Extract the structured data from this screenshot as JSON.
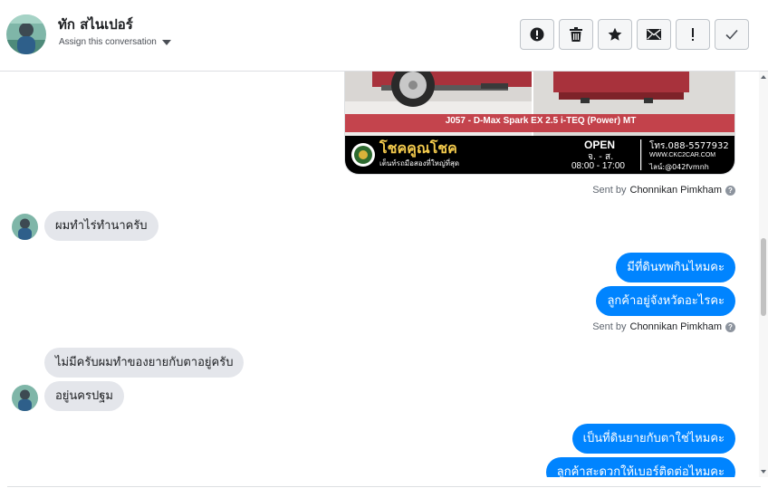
{
  "header": {
    "contact_name": "ทัก สไนเปอร์",
    "assign_label": "Assign this conversation",
    "actions": [
      {
        "icon": "alert-circle-icon",
        "label": "Mark as spam"
      },
      {
        "icon": "trash-icon",
        "label": "Delete"
      },
      {
        "icon": "star-icon",
        "label": "Star"
      },
      {
        "icon": "envelope-icon",
        "label": "Mark as unread"
      },
      {
        "icon": "exclamation-icon",
        "label": "Follow up"
      },
      {
        "icon": "check-icon",
        "label": "Mark as done"
      }
    ]
  },
  "attachment": {
    "caption": "J057 - D-Max Spark EX 2.5 i-TEQ (Power) MT",
    "brand": "โชคคูณโชค",
    "brand_tagline": "เต็นท์รถมือสองที่ใหญ่ที่สุด",
    "open_label": "OPEN",
    "open_days": "จ. - ส.",
    "open_hours": "08:00 - 17:00",
    "phone": "โทร.088-5577932",
    "website": "WWW.CKC2CAR.COM",
    "line": "ไลน์:@042fvmnh"
  },
  "sent_by_prefix": "Sent by",
  "agent_name": "Chonnikan Pimkham",
  "messages": {
    "in_1": "ผมทำไร่ทำนาครับ",
    "out_1": "มีที่ดินทพกินไหมคะ",
    "out_2": "ลูกค้าอยู่จังหวัดอะไรคะ",
    "in_2": "ไม่มีครับผมทำของยายกับตาอยู่ครับ",
    "in_3": "อยู่นครปฐม",
    "out_3": "เป็นที่ดินยายกับตาใช่ไหมคะ",
    "out_4": "ลูกค้าสะดวกให้เบอร์ติดต่อไหมคะ"
  },
  "colors": {
    "outgoing_bubble": "#0084ff",
    "incoming_bubble": "#e4e6eb",
    "banner_black": "#000000",
    "truck_red": "#a8323c"
  }
}
